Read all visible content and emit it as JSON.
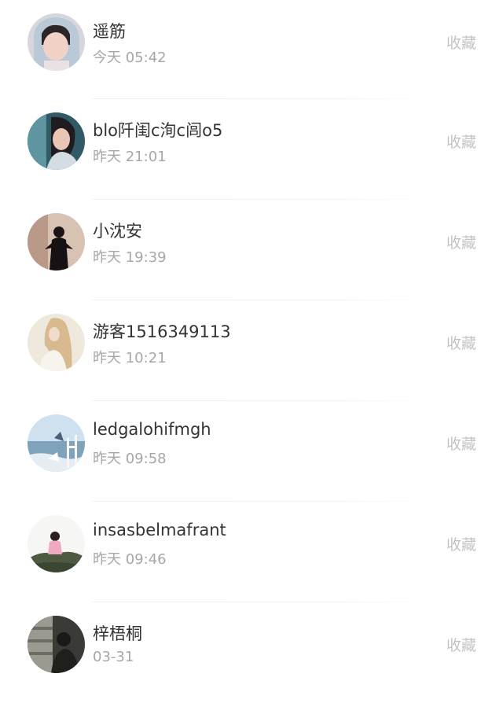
{
  "list": {
    "items": [
      {
        "name": "遥筋",
        "time": "今天 05:42",
        "action": "收藏"
      },
      {
        "name": "blo阡闺c洵c闾o5",
        "time": "昨天 21:01",
        "action": "收藏"
      },
      {
        "name": "小沈安",
        "time": "昨天 19:39",
        "action": "收藏"
      },
      {
        "name": "游客1516349113",
        "time": "昨天 10:21",
        "action": "收藏"
      },
      {
        "name": "ledgalohifmgh",
        "time": "昨天 09:58",
        "action": "收藏"
      },
      {
        "name": "insasbelmafrant",
        "time": "昨天 09:46",
        "action": "收藏"
      },
      {
        "name": "梓梧桐",
        "time": "03-31",
        "action": "收藏"
      }
    ]
  },
  "colors": {
    "name_text": "#333333",
    "time_text": "#a7a7a7",
    "action_text": "#c4c4c4",
    "divider": "#f1f1f1",
    "background": "#ffffff"
  }
}
